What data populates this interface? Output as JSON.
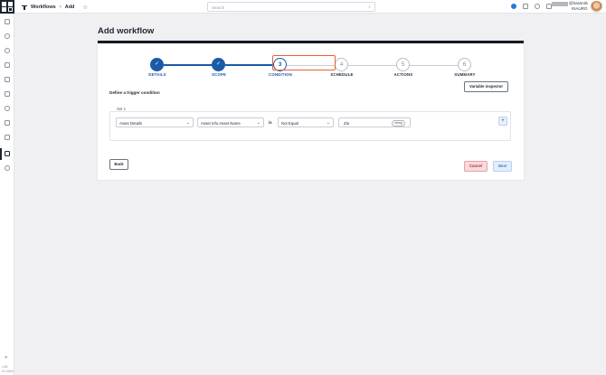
{
  "breadcrumb": {
    "root": "Workflows",
    "separator": "›",
    "current": "Add"
  },
  "search": {
    "placeholder": "Search"
  },
  "user": {
    "name": "@hassnils",
    "org": "INAURO"
  },
  "rail": {
    "version_line1": "v.26",
    "version_line2": "01.2024",
    "expand_glyph": "»"
  },
  "page": {
    "title": "Add workflow"
  },
  "stepper": {
    "steps": [
      {
        "number": "✓",
        "label": "DETAILS",
        "state": "done"
      },
      {
        "number": "✓",
        "label": "SCOPE",
        "state": "done"
      },
      {
        "number": "3",
        "label": "CONDITION",
        "state": "current"
      },
      {
        "number": "4",
        "label": "SCHEDULE",
        "state": "todo"
      },
      {
        "number": "5",
        "label": "ACTIONS",
        "state": "todo"
      },
      {
        "number": "6",
        "label": "SUMMARY",
        "state": "todo"
      }
    ]
  },
  "condition": {
    "heading": "Define a trigger condition",
    "variable_inspector_label": "Variable inspector",
    "set_label": "Set 1",
    "source": "Asset Details",
    "field": "Asset Info.Asset Name",
    "is_label": "is",
    "operator": "Not Equal",
    "value": "Zin",
    "value_type": "string",
    "add_label": "+"
  },
  "footer": {
    "back_label": "Back",
    "cancel_label": "Cancel",
    "next_label": "Next"
  },
  "colors": {
    "accent": "#1a5aa8",
    "highlight": "#e8622f",
    "cancel_bg": "#f9d9dc",
    "dark": "#141b26"
  },
  "icons": [
    "workflow-icon",
    "star-icon",
    "search-icon",
    "notification-icon",
    "help-icon",
    "bell-icon",
    "check-icon"
  ]
}
